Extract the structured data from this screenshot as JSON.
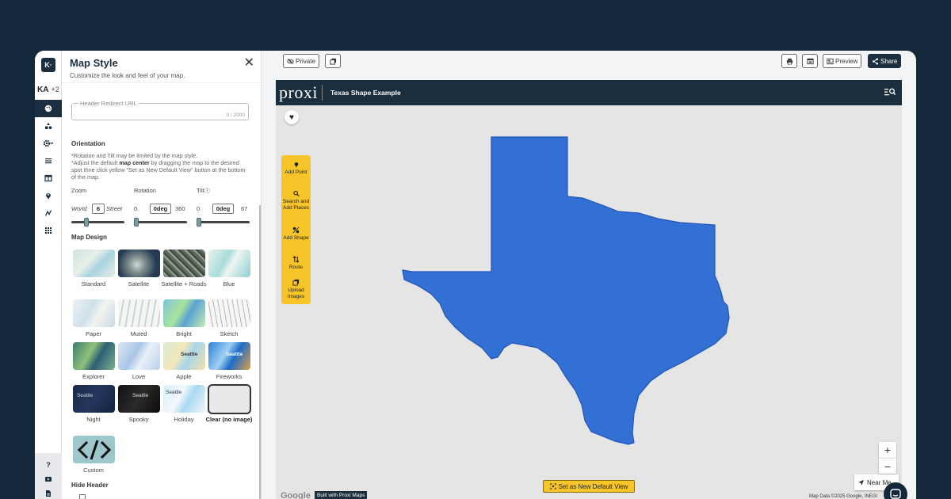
{
  "rail": {
    "logo": "K·",
    "avatar_initials": "KA",
    "avatar_extra": "+2",
    "icons": [
      "palette-icon",
      "shapes-icon",
      "gear-icon",
      "list-icon",
      "table-icon",
      "pin-icon",
      "route-icon",
      "grid-icon"
    ],
    "bottom_icons": [
      "help-icon",
      "video-icon",
      "document-icon"
    ]
  },
  "panel": {
    "title": "Map Style",
    "subtitle": "Customize the look and feel of your map.",
    "redirect_label": "Header Redirect URL",
    "redirect_count": "0 / 2000",
    "orientation_heading": "Orientation",
    "orientation_note_1": "*Rotation and Tilt may be limited by the map style.",
    "orientation_note_2a": "*Adjust the default ",
    "orientation_note_2b": "map center",
    "orientation_note_2c": " by dragging the map to the desired spot thne click yellow \"Set as New Default View\" button at the bottom of the map.",
    "zoom": {
      "label": "Zoom",
      "min": "World",
      "max": "Street",
      "value": "6",
      "level": 0.27
    },
    "rotation": {
      "label": "Rotation",
      "min": "0",
      "max": "360",
      "value": "0deg",
      "level": 0
    },
    "tilt": {
      "label": "Tilt",
      "min": "0",
      "max": "67",
      "value": "0deg",
      "level": 0
    },
    "map_design_heading": "Map Design",
    "styles": [
      {
        "label": "Standard"
      },
      {
        "label": "Satellite"
      },
      {
        "label": "Satellite + Roads"
      },
      {
        "label": "Blue"
      },
      {
        "label": "Paper"
      },
      {
        "label": "Muted"
      },
      {
        "label": "Bright"
      },
      {
        "label": "Sketch"
      },
      {
        "label": "Explorer",
        "tile_text": ""
      },
      {
        "label": "Love"
      },
      {
        "label": "Apple",
        "tile_text": "Seattle"
      },
      {
        "label": "Fireworks",
        "tile_text": "Seattle"
      },
      {
        "label": "Night",
        "tile_text": "Seattle"
      },
      {
        "label": "Spooky",
        "tile_text": "Seattle"
      },
      {
        "label": "Holiday",
        "tile_text": "Seattle"
      },
      {
        "label": "Clear (no image)",
        "selected": true
      }
    ],
    "custom_label": "Custom",
    "hide_header_heading": "Hide Header"
  },
  "toolbar": {
    "private_label": "Private",
    "preview_label": "Preview",
    "share_label": "Share"
  },
  "map": {
    "brand": "proxi",
    "title": "Texas Shape Example",
    "tools": [
      "Add Point",
      "Search and Add Places",
      "Add Shape",
      "Route",
      "Upload Images"
    ],
    "zoom_in": "+",
    "zoom_out": "−",
    "near_me": "Near Me",
    "set_default": "Set as New Default View",
    "google": "Google",
    "built_with": "Built with Proxi Maps",
    "attribution": "Map Data ©2025 Google, INEGI",
    "shape_color": "#3370d4"
  },
  "colors": {
    "navy": "#1c2f40",
    "accent": "#f7c52a",
    "background": "#13283a"
  }
}
